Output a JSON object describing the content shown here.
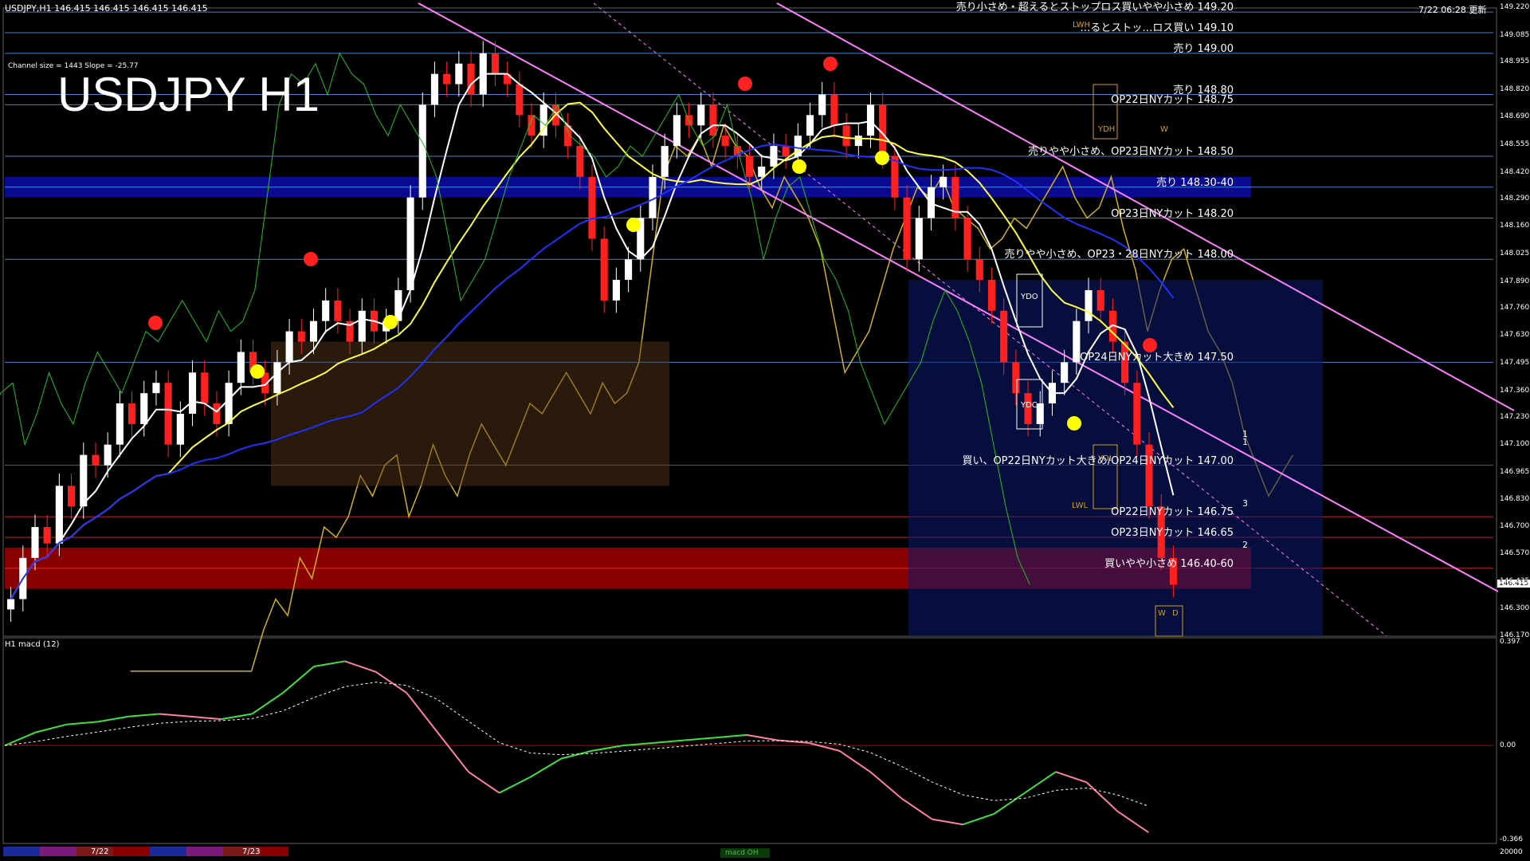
{
  "header": {
    "symbol_info": "USDJPY,H1  146.415 146.415 146.415 146.415",
    "timestamp": "7/22 06:28 更新"
  },
  "title": "USDJPY H1",
  "channel_info": "Channel size = 1443 Slope = -25.77",
  "macd_label": "H1  macd (12)",
  "current_price": "146.415",
  "price_axis": [
    "149.220",
    "149.085",
    "148.955",
    "148.820",
    "148.690",
    "148.555",
    "148.420",
    "148.290",
    "148.160",
    "148.025",
    "147.890",
    "147.760",
    "147.630",
    "147.495",
    "147.360",
    "147.230",
    "147.100",
    "146.965",
    "146.830",
    "146.700",
    "146.570",
    "146.435",
    "146.300",
    "146.170"
  ],
  "macd_axis": {
    "top": "0.397",
    "zero": "0.00",
    "bottom": "-0.366",
    "vol": "20000"
  },
  "levels": [
    {
      "text": "売り小さめ・超えるとストップロス買いやや小さめ 149.20",
      "price": 149.2,
      "color": "#5aa0ff"
    },
    {
      "text": "…るとストッ…ロス買い 149.10",
      "price": 149.1,
      "color": "#5aa0ff"
    },
    {
      "text": "売り 149.00",
      "price": 149.0,
      "color": "#5aa0ff"
    },
    {
      "text": "売り 148.80",
      "price": 148.8,
      "color": "#5aa0ff"
    },
    {
      "text": "OP22日NYカット 148.75",
      "price": 148.75,
      "color": "#5aa0ff"
    },
    {
      "text": "売りやや小さめ、OP23日NYカット 148.50",
      "price": 148.5,
      "color": "#5aa0ff"
    },
    {
      "text": "売り 148.30-40",
      "price": 148.35,
      "color": "#5aa0ff"
    },
    {
      "text": "OP23日NYカット 148.20",
      "price": 148.2,
      "color": "#5aa0ff"
    },
    {
      "text": "売りやや小さめ、OP23・28日NYカット 148.00",
      "price": 148.0,
      "color": "#5aa0ff"
    },
    {
      "text": "OP24日NYカット大きめ 147.50",
      "price": 147.5,
      "color": "#5aa0ff"
    },
    {
      "text": "買い、OP22日NYカット大きめ/OP24日NYカット 147.00",
      "price": 147.0,
      "color": "#ff3030"
    },
    {
      "text": "OP22日NYカット 146.75",
      "price": 146.75,
      "color": "#ff3030"
    },
    {
      "text": "OP23日NYカット 146.65",
      "price": 146.65,
      "color": "#ff3030"
    },
    {
      "text": "買いやや小さめ 146.40-60",
      "price": 146.5,
      "color": "#ff3030"
    }
  ],
  "box_tags": [
    "LWH",
    "YDH",
    "W",
    "YDO",
    "YDC",
    "YDL",
    "LWL",
    "W",
    "D"
  ],
  "side_numbers": [
    "1",
    "1",
    "3",
    "2"
  ],
  "date_tabs": [
    "7/22",
    "7/23"
  ],
  "macd_tab": "macd OH",
  "colors": {
    "up": "#ffffff",
    "down": "#ff2020",
    "ma_fast": "#ffffff",
    "ma_mid": "#ffff40",
    "ma_slow": "#2030ff",
    "chikou": "#20c020",
    "channel": "#ff80ff",
    "sell_zone": "#0a0a90",
    "buy_zone": "#8a0000",
    "macd_up": "#40e040",
    "macd_down": "#ff80a0"
  },
  "chart_data": {
    "type": "candlestick",
    "symbol": "USDJPY",
    "timeframe": "H1",
    "ylim": [
      146.17,
      149.22
    ],
    "sell_zone": [
      148.3,
      148.4
    ],
    "buy_zone": [
      146.4,
      146.6
    ],
    "close": [
      146.35,
      146.55,
      146.7,
      146.62,
      146.9,
      146.8,
      147.05,
      147.0,
      147.1,
      147.3,
      147.2,
      147.35,
      147.4,
      147.1,
      147.25,
      147.45,
      147.3,
      147.2,
      147.4,
      147.55,
      147.45,
      147.35,
      147.5,
      147.65,
      147.6,
      147.7,
      147.8,
      147.7,
      147.6,
      147.75,
      147.65,
      147.7,
      147.85,
      148.3,
      148.75,
      148.9,
      148.85,
      148.95,
      148.8,
      149.0,
      148.9,
      148.85,
      148.7,
      148.6,
      148.75,
      148.65,
      148.55,
      148.4,
      148.1,
      147.8,
      147.9,
      148.0,
      148.2,
      148.4,
      148.55,
      148.7,
      148.65,
      148.75,
      148.6,
      148.55,
      148.5,
      148.4,
      148.45,
      148.55,
      148.5,
      148.6,
      148.7,
      148.8,
      148.65,
      148.55,
      148.6,
      148.75,
      148.5,
      148.3,
      148.0,
      148.2,
      148.35,
      148.4,
      148.2,
      148.0,
      147.9,
      147.75,
      147.5,
      147.35,
      147.2,
      147.3,
      147.4,
      147.5,
      147.7,
      147.85,
      147.75,
      147.6,
      147.4,
      147.1,
      146.8,
      146.55,
      146.42
    ],
    "macd": [
      0.0,
      0.05,
      0.08,
      0.09,
      0.11,
      0.12,
      0.11,
      0.1,
      0.12,
      0.2,
      0.3,
      0.32,
      0.28,
      0.2,
      0.05,
      -0.1,
      -0.18,
      -0.12,
      -0.05,
      -0.02,
      0.0,
      0.01,
      0.02,
      0.03,
      0.04,
      0.02,
      0.01,
      -0.02,
      -0.1,
      -0.2,
      -0.28,
      -0.3,
      -0.26,
      -0.18,
      -0.1,
      -0.14,
      -0.25,
      -0.33
    ]
  }
}
